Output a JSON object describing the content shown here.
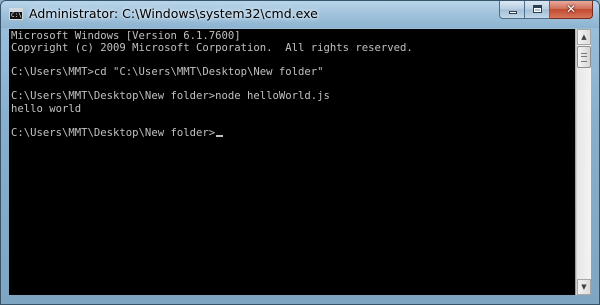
{
  "window": {
    "title": "Administrator: C:\\Windows\\system32\\cmd.exe",
    "app_icon_label": "C:\\",
    "controls": {
      "minimize": "minimize",
      "maximize": "maximize",
      "close_glyph": "✕"
    }
  },
  "console": {
    "lines": [
      "Microsoft Windows [Version 6.1.7600]",
      "Copyright (c) 2009 Microsoft Corporation.  All rights reserved.",
      "",
      "C:\\Users\\MMT>cd \"C:\\Users\\MMT\\Desktop\\New folder\"",
      "",
      "C:\\Users\\MMT\\Desktop\\New folder>node helloWorld.js",
      "hello world",
      "",
      "C:\\Users\\MMT\\Desktop\\New folder>"
    ],
    "text_color": "#c0c0c0",
    "background_color": "#000000"
  },
  "scrollbar": {
    "up_arrow": "▲",
    "down_arrow": "▼"
  }
}
